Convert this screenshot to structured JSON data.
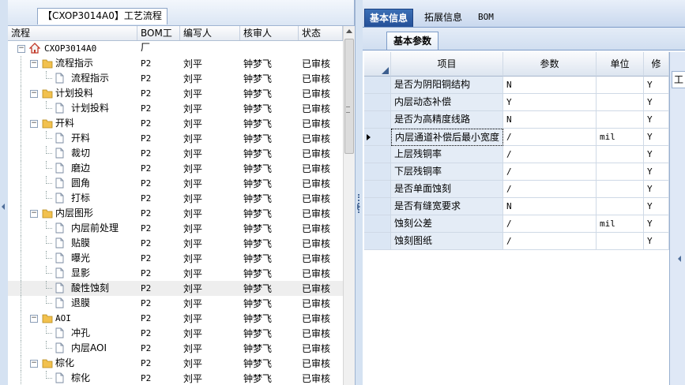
{
  "left": {
    "title": "【CXOP3014A0】工艺流程",
    "columns": [
      "流程",
      "BOM工厂",
      "编写人",
      "核审人",
      "状态"
    ],
    "root": "CXOP3014A0",
    "rows": [
      {
        "label": "流程指示",
        "level": 1,
        "type": "folder",
        "bom": "P2",
        "writer": "刘平",
        "reviewer": "钟梦飞",
        "status": "已审核"
      },
      {
        "label": "流程指示",
        "level": 2,
        "type": "doc",
        "bom": "P2",
        "writer": "刘平",
        "reviewer": "钟梦飞",
        "status": "已审核"
      },
      {
        "label": "计划投料",
        "level": 1,
        "type": "folder",
        "bom": "P2",
        "writer": "刘平",
        "reviewer": "钟梦飞",
        "status": "已审核"
      },
      {
        "label": "计划投料",
        "level": 2,
        "type": "doc",
        "bom": "P2",
        "writer": "刘平",
        "reviewer": "钟梦飞",
        "status": "已审核"
      },
      {
        "label": "开料",
        "level": 1,
        "type": "folder",
        "bom": "P2",
        "writer": "刘平",
        "reviewer": "钟梦飞",
        "status": "已审核"
      },
      {
        "label": "开料",
        "level": 2,
        "type": "doc",
        "bom": "P2",
        "writer": "刘平",
        "reviewer": "钟梦飞",
        "status": "已审核"
      },
      {
        "label": "裁切",
        "level": 2,
        "type": "doc",
        "bom": "P2",
        "writer": "刘平",
        "reviewer": "钟梦飞",
        "status": "已审核"
      },
      {
        "label": "磨边",
        "level": 2,
        "type": "doc",
        "bom": "P2",
        "writer": "刘平",
        "reviewer": "钟梦飞",
        "status": "已审核"
      },
      {
        "label": "圆角",
        "level": 2,
        "type": "doc",
        "bom": "P2",
        "writer": "刘平",
        "reviewer": "钟梦飞",
        "status": "已审核"
      },
      {
        "label": "打标",
        "level": 2,
        "type": "doc",
        "bom": "P2",
        "writer": "刘平",
        "reviewer": "钟梦飞",
        "status": "已审核"
      },
      {
        "label": "内层图形",
        "level": 1,
        "type": "folder",
        "bom": "P2",
        "writer": "刘平",
        "reviewer": "钟梦飞",
        "status": "已审核"
      },
      {
        "label": "内层前处理",
        "level": 2,
        "type": "doc",
        "bom": "P2",
        "writer": "刘平",
        "reviewer": "钟梦飞",
        "status": "已审核"
      },
      {
        "label": "贴膜",
        "level": 2,
        "type": "doc",
        "bom": "P2",
        "writer": "刘平",
        "reviewer": "钟梦飞",
        "status": "已审核"
      },
      {
        "label": "曝光",
        "level": 2,
        "type": "doc",
        "bom": "P2",
        "writer": "刘平",
        "reviewer": "钟梦飞",
        "status": "已审核"
      },
      {
        "label": "显影",
        "level": 2,
        "type": "doc",
        "bom": "P2",
        "writer": "刘平",
        "reviewer": "钟梦飞",
        "status": "已审核"
      },
      {
        "label": "酸性蚀刻",
        "level": 2,
        "type": "doc",
        "bom": "P2",
        "writer": "刘平",
        "reviewer": "钟梦飞",
        "status": "已审核",
        "selected": true
      },
      {
        "label": "退膜",
        "level": 2,
        "type": "doc",
        "bom": "P2",
        "writer": "刘平",
        "reviewer": "钟梦飞",
        "status": "已审核"
      },
      {
        "label": "AOI",
        "level": 1,
        "type": "folder",
        "bom": "P2",
        "writer": "刘平",
        "reviewer": "钟梦飞",
        "status": "已审核"
      },
      {
        "label": "冲孔",
        "level": 2,
        "type": "doc",
        "bom": "P2",
        "writer": "刘平",
        "reviewer": "钟梦飞",
        "status": "已审核"
      },
      {
        "label": "内层AOI",
        "level": 2,
        "type": "doc",
        "bom": "P2",
        "writer": "刘平",
        "reviewer": "钟梦飞",
        "status": "已审核"
      },
      {
        "label": "棕化",
        "level": 1,
        "type": "folder",
        "bom": "P2",
        "writer": "刘平",
        "reviewer": "钟梦飞",
        "status": "已审核"
      },
      {
        "label": "棕化",
        "level": 2,
        "type": "doc",
        "bom": "P2",
        "writer": "刘平",
        "reviewer": "钟梦飞",
        "status": "已审核"
      }
    ]
  },
  "right": {
    "tabs": [
      "基本信息",
      "拓展信息",
      "BOM"
    ],
    "active_tab": 0,
    "subtab": "基本参数",
    "columns": [
      "项目",
      "参数",
      "单位",
      "修"
    ],
    "rows": [
      {
        "item": "是否为阴阳铜结构",
        "param": "N",
        "unit": "",
        "mod": "Y"
      },
      {
        "item": "内层动态补偿",
        "param": "Y",
        "unit": "",
        "mod": "Y"
      },
      {
        "item": "是否为高精度线路",
        "param": "N",
        "unit": "",
        "mod": "Y"
      },
      {
        "item": "内层通道补偿后最小宽度",
        "param": "/",
        "unit": "mil",
        "mod": "Y",
        "current": true
      },
      {
        "item": "上层残铜率",
        "param": "/",
        "unit": "",
        "mod": "Y"
      },
      {
        "item": "下层残铜率",
        "param": "/",
        "unit": "",
        "mod": "Y"
      },
      {
        "item": "是否单面蚀刻",
        "param": "/",
        "unit": "",
        "mod": "Y"
      },
      {
        "item": "是否有缝宽要求",
        "param": "N",
        "unit": "",
        "mod": "Y"
      },
      {
        "item": "蚀刻公差",
        "param": "/",
        "unit": "mil",
        "mod": "Y"
      },
      {
        "item": "蚀刻图纸",
        "param": "/",
        "unit": "",
        "mod": "Y"
      }
    ],
    "edge_label": "工"
  },
  "colors": {
    "accent": "#245098",
    "panel_bg": "#dfe8f6",
    "folder": "#f2c14e"
  }
}
